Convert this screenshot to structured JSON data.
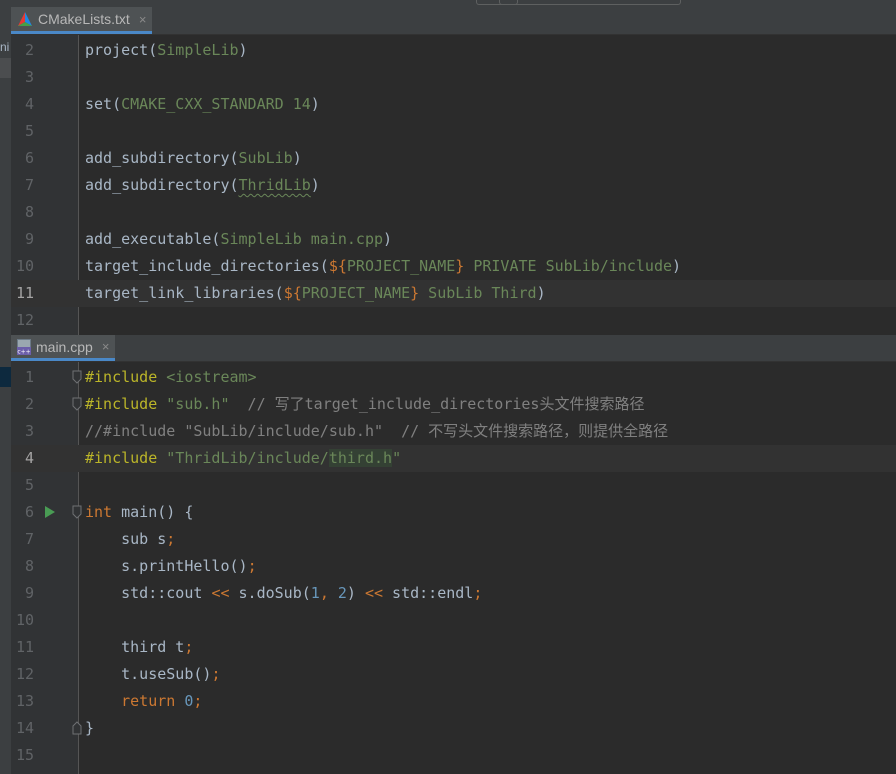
{
  "tabs": {
    "cmake": {
      "label": "CMakeLists.txt",
      "close": "×"
    },
    "main": {
      "label": "main.cpp",
      "close": "×"
    }
  },
  "left_strip": {
    "fragment": "ni"
  },
  "icons": {
    "cmake": "cmake-triangle-icon",
    "cpp": "cpp-file-icon",
    "run": "run-gutter-icon",
    "fold": "fold-marker-icon"
  },
  "colors": {
    "keyword": "#cc7832",
    "directive": "#bbb529",
    "string": "#6a8759",
    "comment": "#808080",
    "number": "#6897bb",
    "macro": "#9876aa",
    "plain": "#a9b7c6",
    "background": "#2b2b2b",
    "tab_underline": "#4a88c7"
  },
  "cmake_lines": [
    {
      "num": "2",
      "tokens": [
        {
          "t": "project(",
          "c": "pl"
        },
        {
          "t": "SimpleLib",
          "c": "str"
        },
        {
          "t": ")",
          "c": "pl"
        }
      ]
    },
    {
      "num": "3",
      "tokens": []
    },
    {
      "num": "4",
      "tokens": [
        {
          "t": "set(",
          "c": "pl"
        },
        {
          "t": "CMAKE_CXX_STANDARD 14",
          "c": "str"
        },
        {
          "t": ")",
          "c": "pl"
        }
      ]
    },
    {
      "num": "5",
      "tokens": []
    },
    {
      "num": "6",
      "tokens": [
        {
          "t": "add_subdirectory(",
          "c": "pl"
        },
        {
          "t": "SubLib",
          "c": "str"
        },
        {
          "t": ")",
          "c": "pl"
        }
      ]
    },
    {
      "num": "7",
      "tokens": [
        {
          "t": "add_subdirectory(",
          "c": "pl"
        },
        {
          "t": "ThridLib",
          "c": "str typo"
        },
        {
          "t": ")",
          "c": "pl"
        }
      ]
    },
    {
      "num": "8",
      "tokens": []
    },
    {
      "num": "9",
      "tokens": [
        {
          "t": "add_executable(",
          "c": "pl"
        },
        {
          "t": "SimpleLib main.cpp",
          "c": "str"
        },
        {
          "t": ")",
          "c": "pl"
        }
      ]
    },
    {
      "num": "10",
      "tokens": [
        {
          "t": "target_include_directories(",
          "c": "pl"
        },
        {
          "t": "${",
          "c": "kw"
        },
        {
          "t": "PROJECT_NAME",
          "c": "str"
        },
        {
          "t": "}",
          "c": "kw"
        },
        {
          "t": " PRIVATE SubLib/include",
          "c": "str"
        },
        {
          "t": ")",
          "c": "pl"
        }
      ]
    },
    {
      "num": "11",
      "current": true,
      "tokens": [
        {
          "t": "target_link_libraries(",
          "c": "pl"
        },
        {
          "t": "${",
          "c": "kw"
        },
        {
          "t": "PROJECT_NAME",
          "c": "str"
        },
        {
          "t": "}",
          "c": "kw"
        },
        {
          "t": " SubLib Third",
          "c": "str"
        },
        {
          "t": ")",
          "c": "pl"
        }
      ]
    },
    {
      "num": "12",
      "tokens": []
    }
  ],
  "main_lines": [
    {
      "num": "1",
      "fold": true,
      "tokens": [
        {
          "t": "#include ",
          "c": "dir"
        },
        {
          "t": "<iostream>",
          "c": "str"
        }
      ]
    },
    {
      "num": "2",
      "fold": true,
      "tokens": [
        {
          "t": "#include ",
          "c": "dir"
        },
        {
          "t": "\"sub.h\"",
          "c": "str"
        },
        {
          "t": "  // 写了target_include_directories头文件搜索路径",
          "c": "cmt"
        }
      ]
    },
    {
      "num": "3",
      "tokens": [
        {
          "t": "//#include \"SubLib/include/sub.h\"  // 不写头文件搜索路径，则提供全路径",
          "c": "cmt"
        }
      ]
    },
    {
      "num": "4",
      "current": true,
      "tokens": [
        {
          "t": "#include ",
          "c": "dir"
        },
        {
          "t": "\"ThridLib/include/",
          "c": "str"
        },
        {
          "t": "third.h",
          "c": "str hl"
        },
        {
          "t": "\"",
          "c": "str"
        }
      ]
    },
    {
      "num": "5",
      "tokens": []
    },
    {
      "num": "6",
      "run": true,
      "fold": true,
      "tokens": [
        {
          "t": "int",
          "c": "kw"
        },
        {
          "t": " main() {",
          "c": "pl"
        }
      ]
    },
    {
      "num": "7",
      "tokens": [
        {
          "t": "    sub s",
          "c": "pl"
        },
        {
          "t": ";",
          "c": "kw"
        }
      ]
    },
    {
      "num": "8",
      "tokens": [
        {
          "t": "    s.printHello()",
          "c": "pl"
        },
        {
          "t": ";",
          "c": "kw"
        }
      ]
    },
    {
      "num": "9",
      "tokens": [
        {
          "t": "    std::cout ",
          "c": "pl"
        },
        {
          "t": "<<",
          "c": "kw"
        },
        {
          "t": " s.doSub(",
          "c": "pl"
        },
        {
          "t": "1",
          "c": "num"
        },
        {
          "t": ", ",
          "c": "kw"
        },
        {
          "t": "2",
          "c": "num"
        },
        {
          "t": ") ",
          "c": "pl"
        },
        {
          "t": "<<",
          "c": "kw"
        },
        {
          "t": " std::endl",
          "c": "pl"
        },
        {
          "t": ";",
          "c": "kw"
        }
      ]
    },
    {
      "num": "10",
      "tokens": []
    },
    {
      "num": "11",
      "tokens": [
        {
          "t": "    third t",
          "c": "pl"
        },
        {
          "t": ";",
          "c": "kw"
        }
      ]
    },
    {
      "num": "12",
      "tokens": [
        {
          "t": "    t.useSub()",
          "c": "pl"
        },
        {
          "t": ";",
          "c": "kw"
        }
      ]
    },
    {
      "num": "13",
      "tokens": [
        {
          "t": "    ",
          "c": "pl"
        },
        {
          "t": "return ",
          "c": "kw"
        },
        {
          "t": "0",
          "c": "num"
        },
        {
          "t": ";",
          "c": "kw"
        }
      ]
    },
    {
      "num": "14",
      "fold": true,
      "tokens": [
        {
          "t": "}",
          "c": "pl"
        }
      ]
    },
    {
      "num": "15",
      "tokens": []
    }
  ]
}
